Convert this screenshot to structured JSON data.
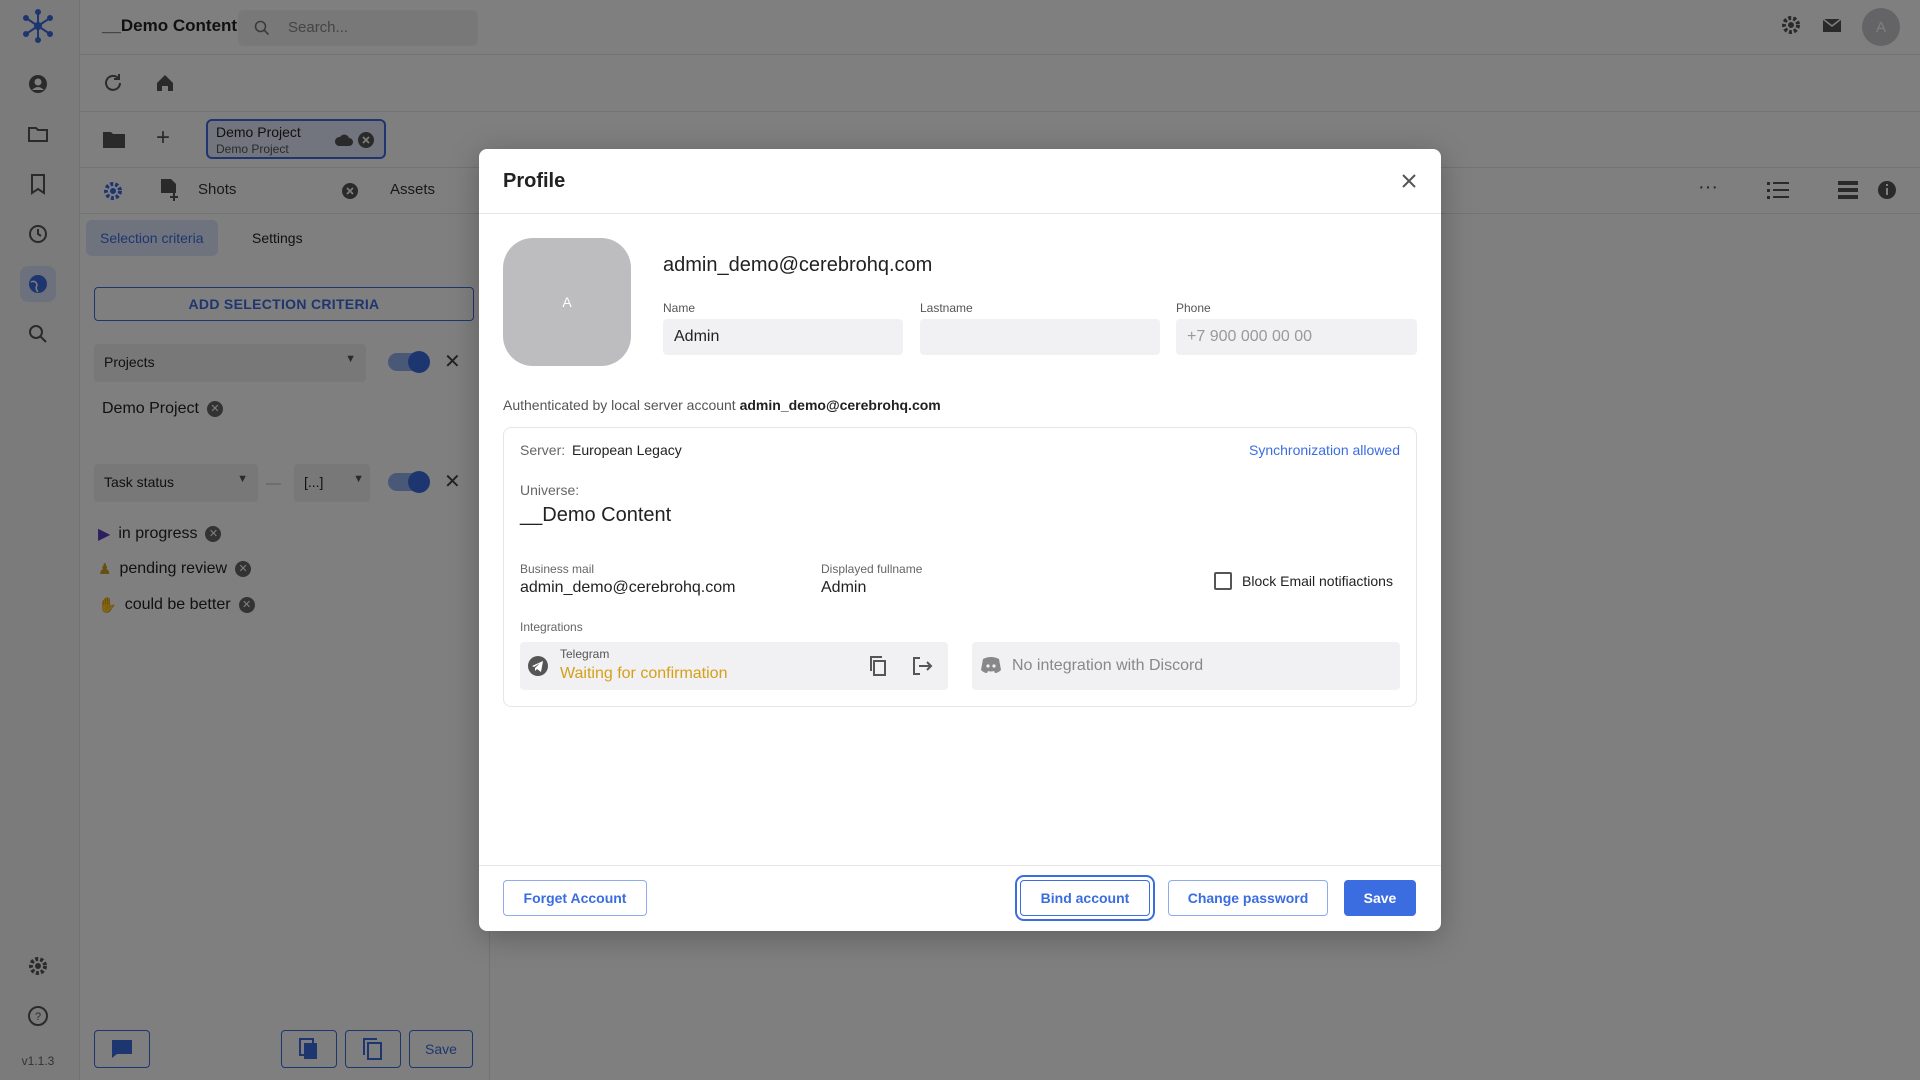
{
  "app": {
    "universe_title": "__Demo Content",
    "search_placeholder": "Search...",
    "avatar_letter": "A",
    "version": "v1.1.3"
  },
  "tabs": {
    "project_tab": {
      "title": "Demo Project",
      "subtitle": "Demo Project"
    },
    "shots_label": "Shots",
    "assets_label": "Assets"
  },
  "left_panel": {
    "subtabs": [
      "Selection criteria",
      "Settings"
    ],
    "add_criteria_label": "ADD SELECTION CRITERIA",
    "projects_filter": {
      "label": "Projects",
      "chip": "Demo Project"
    },
    "status_filter": {
      "label": "Task status",
      "bracket": "[...]",
      "statuses": [
        "in progress",
        "pending review",
        "could be better"
      ]
    },
    "save_label": "Save"
  },
  "modal": {
    "title": "Profile",
    "avatar_letter": "A",
    "email": "admin_demo@cerebrohq.com",
    "fields": {
      "name_label": "Name",
      "name_value": "Admin",
      "lastname_label": "Lastname",
      "lastname_value": "",
      "phone_label": "Phone",
      "phone_placeholder": "+7 900 000 00 00"
    },
    "auth_prefix": "Authenticated by local server account",
    "auth_account": "admin_demo@cerebrohq.com",
    "server_label": "Server:",
    "server_value": "European Legacy",
    "sync_status": "Synchronization allowed",
    "universe_label": "Universe:",
    "universe_value": "__Demo Content",
    "business_mail_label": "Business mail",
    "business_mail_value": "admin_demo@cerebrohq.com",
    "display_name_label": "Displayed fullname",
    "display_name_value": "Admin",
    "block_email_label": "Block Email notifiactions",
    "block_email_checked": false,
    "integrations_label": "Integrations",
    "telegram_name": "Telegram",
    "telegram_status": "Waiting for confirmation",
    "discord_status": "No integration with Discord",
    "buttons": {
      "forget": "Forget Account",
      "bind": "Bind account",
      "change_password": "Change password",
      "save": "Save"
    }
  },
  "colors": {
    "accent": "#3b6de0",
    "warning": "#d4a017",
    "overlay": "rgba(0,0,0,0.5)"
  }
}
